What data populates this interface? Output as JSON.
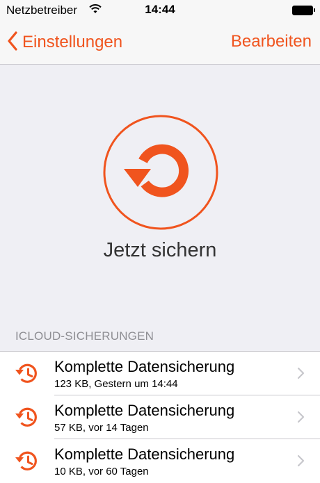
{
  "status_bar": {
    "carrier": "Netzbetreiber",
    "time": "14:44"
  },
  "nav": {
    "back_label": "Einstellungen",
    "edit_label": "Bearbeiten"
  },
  "backup_now": {
    "label": "Jetzt sichern"
  },
  "section_header": "ICLOUD-SICHERUNGEN",
  "backups": [
    {
      "title": "Komplette Datensicherung",
      "subtitle": "123 KB, Gestern um 14:44"
    },
    {
      "title": "Komplette Datensicherung",
      "subtitle": "57 KB, vor 14 Tagen"
    },
    {
      "title": "Komplette Datensicherung",
      "subtitle": "10 KB, vor 60 Tagen"
    }
  ],
  "colors": {
    "accent": "#f0541e",
    "background": "#efeff4",
    "secondary_text": "#8e8e93"
  },
  "icons": {
    "back": "chevron-left-icon",
    "wifi": "wifi-icon",
    "battery": "battery-icon",
    "backup_now": "backup-now-icon",
    "history": "history-clock-icon",
    "disclosure": "chevron-right-icon"
  }
}
